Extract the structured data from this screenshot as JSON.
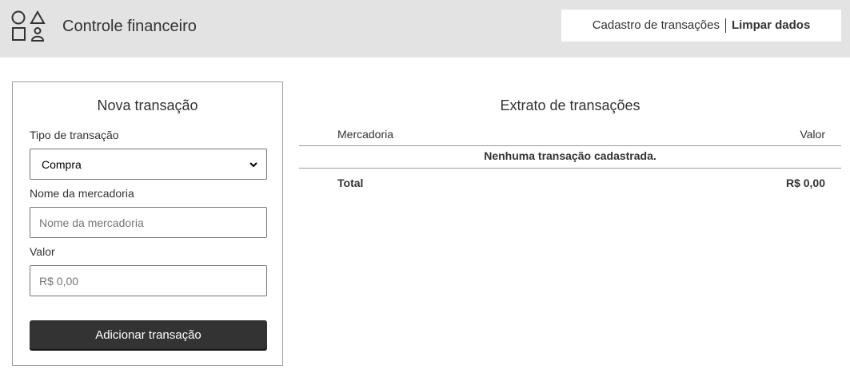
{
  "header": {
    "title": "Controle financeiro",
    "logo_icon": "shapes-icon",
    "nav": [
      {
        "label": "Cadastro de transações"
      },
      {
        "label": "Limpar dados"
      }
    ]
  },
  "form": {
    "title": "Nova transação",
    "type_label": "Tipo de transação",
    "type_selected": "Compra",
    "name_label": "Nome da mercadoria",
    "name_placeholder": "Nome da mercadoria",
    "name_value": "",
    "value_label": "Valor",
    "value_placeholder": "R$ 0,00",
    "value_value": "",
    "submit_label": "Adicionar transação"
  },
  "statement": {
    "title": "Extrato de transações",
    "columns": [
      "Mercadoria",
      "Valor"
    ],
    "empty_message": "Nenhuma transação cadastrada.",
    "total_label": "Total",
    "total_value": "R$ 0,00"
  },
  "colors": {
    "header_bg": "#e3e3e3",
    "text": "#333333",
    "button_bg": "#333333",
    "button_text": "#ffffff"
  }
}
